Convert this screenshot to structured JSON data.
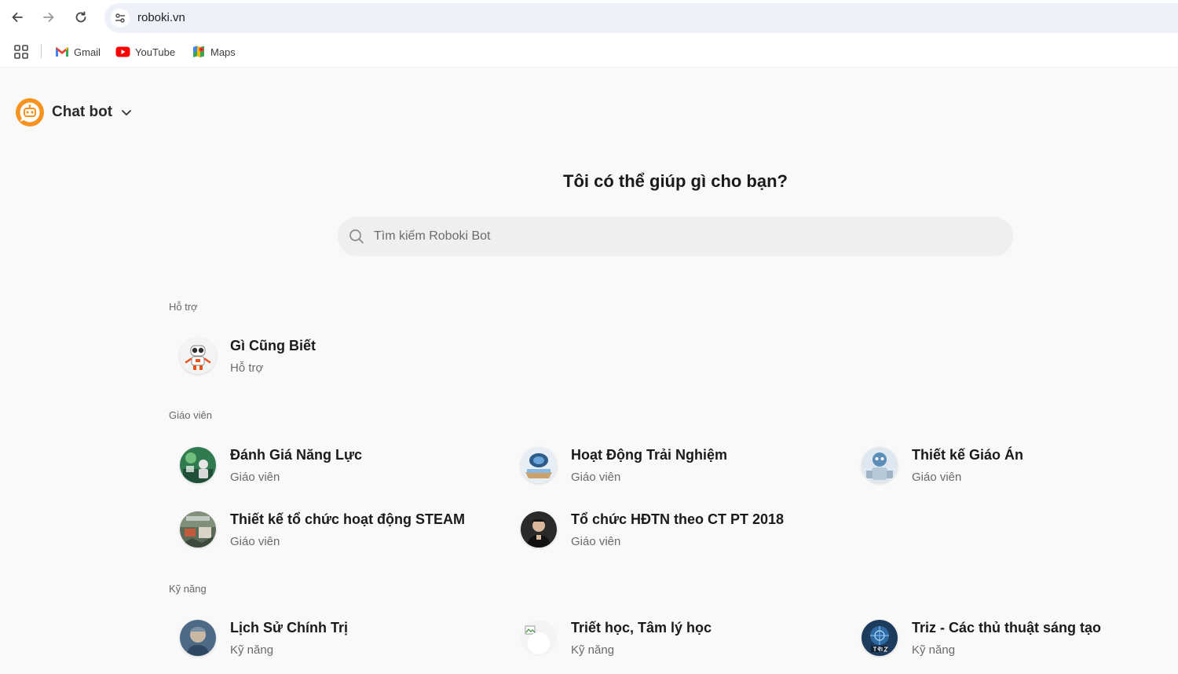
{
  "browser": {
    "url": "roboki.vn",
    "bookmarks": [
      {
        "label": "Gmail",
        "icon": "gmail-icon"
      },
      {
        "label": "YouTube",
        "icon": "youtube-icon"
      },
      {
        "label": "Maps",
        "icon": "maps-icon"
      }
    ]
  },
  "header": {
    "brand": "Chat bot",
    "accent_color": "#f7931e"
  },
  "hero": {
    "title": "Tôi có thể giúp gì cho bạn?",
    "search_placeholder": "Tìm kiếm Roboki Bot"
  },
  "sections": [
    {
      "label": "Hỗ trợ",
      "bots": [
        {
          "title": "Gì Cũng Biết",
          "subtitle": "Hỗ trợ",
          "avatar": "robot-avatar"
        }
      ]
    },
    {
      "label": "Giáo viên",
      "bots": [
        {
          "title": "Đánh Giá Năng Lực",
          "subtitle": "Giáo viên",
          "avatar": "assessment-avatar"
        },
        {
          "title": "Hoạt Động Trải Nghiệm",
          "subtitle": "Giáo viên",
          "avatar": "experience-avatar"
        },
        {
          "title": "Thiết kế Giáo Án",
          "subtitle": "Giáo viên",
          "avatar": "lesson-plan-avatar"
        },
        {
          "title": "Thiết kế tổ chức hoạt động STEAM",
          "subtitle": "Giáo viên",
          "avatar": "steam-avatar"
        },
        {
          "title": "Tổ chức HĐTN theo CT PT 2018",
          "subtitle": "Giáo viên",
          "avatar": "person-avatar"
        }
      ]
    },
    {
      "label": "Kỹ năng",
      "bots": [
        {
          "title": "Lịch Sử Chính Trị",
          "subtitle": "Kỹ năng",
          "avatar": "history-avatar"
        },
        {
          "title": "Triết học, Tâm lý học",
          "subtitle": "Kỹ năng",
          "avatar": "broken-image-avatar"
        },
        {
          "title": "Triz - Các thủ thuật sáng tạo",
          "subtitle": "Kỹ năng",
          "avatar": "triz-avatar"
        }
      ]
    }
  ]
}
